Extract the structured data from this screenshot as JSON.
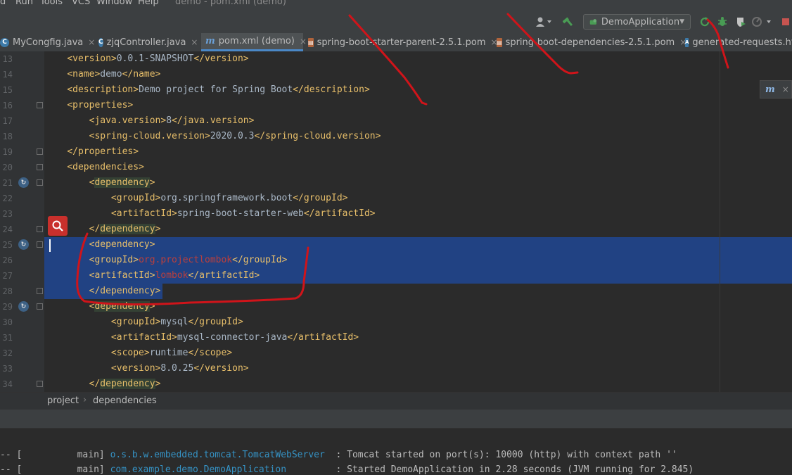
{
  "menubar": {
    "items": [
      {
        "label": "d"
      },
      {
        "label": "Run"
      },
      {
        "label": "Tools"
      },
      {
        "label": "VCS"
      },
      {
        "label": "Window"
      },
      {
        "label": "Help"
      }
    ],
    "window_title": "demo - pom.xml (demo)"
  },
  "toolbar": {
    "run_config": "DemoApplication",
    "icons": [
      "user-icon",
      "hammer-icon",
      "run-config-icon",
      "rerun-icon",
      "debug-icon",
      "coverage-icon",
      "profile-icon",
      "stop-icon"
    ],
    "colors": {
      "run": "#499c54",
      "stop": "#c75450",
      "debug": "#499c54"
    }
  },
  "tabs": [
    {
      "label": "MyCongfig.java",
      "icon": "java-class-icon",
      "active": false
    },
    {
      "label": "zjqController.java",
      "icon": "java-class-icon",
      "active": false
    },
    {
      "label": "pom.xml (demo)",
      "icon": "maven-icon",
      "active": true
    },
    {
      "label": "spring-boot-starter-parent-2.5.1.pom",
      "icon": "pom-file-icon",
      "active": false
    },
    {
      "label": "spring-boot-dependencies-2.5.1.pom",
      "icon": "pom-file-icon",
      "active": false
    },
    {
      "label": "generated-requests.htt",
      "icon": "http-file-icon",
      "active": false
    }
  ],
  "editor": {
    "lines": [
      {
        "num": "13",
        "indent": "    ",
        "parts": [
          [
            "tg",
            "<version>"
          ],
          [
            "tx",
            "0.0.1-SNAPSHOT"
          ],
          [
            "tg",
            "</version>"
          ]
        ]
      },
      {
        "num": "14",
        "indent": "    ",
        "parts": [
          [
            "tg",
            "<name>"
          ],
          [
            "tx",
            "demo"
          ],
          [
            "tg",
            "</name>"
          ]
        ]
      },
      {
        "num": "15",
        "indent": "    ",
        "parts": [
          [
            "tg",
            "<description>"
          ],
          [
            "tx",
            "Demo project for Spring Boot"
          ],
          [
            "tg",
            "</description>"
          ]
        ]
      },
      {
        "num": "16",
        "indent": "    ",
        "parts": [
          [
            "tg",
            "<properties>"
          ]
        ]
      },
      {
        "num": "17",
        "indent": "        ",
        "parts": [
          [
            "tg",
            "<java.version>"
          ],
          [
            "tx",
            "8"
          ],
          [
            "tg",
            "</java.version>"
          ]
        ]
      },
      {
        "num": "18",
        "indent": "        ",
        "parts": [
          [
            "tg",
            "<spring-cloud.version>"
          ],
          [
            "tx",
            "2020.0.3"
          ],
          [
            "tg",
            "</spring-cloud.version>"
          ]
        ]
      },
      {
        "num": "19",
        "indent": "    ",
        "parts": [
          [
            "tg",
            "</properties>"
          ]
        ]
      },
      {
        "num": "20",
        "indent": "    ",
        "parts": [
          [
            "tg",
            "<dependencies>"
          ]
        ]
      },
      {
        "num": "21",
        "indent": "        ",
        "parts": [
          [
            "tg",
            "<"
          ],
          [
            "tgbg",
            "dependency"
          ],
          [
            "tg",
            ">"
          ]
        ]
      },
      {
        "num": "22",
        "indent": "            ",
        "parts": [
          [
            "tg",
            "<groupId>"
          ],
          [
            "tx",
            "org.springframework.boot"
          ],
          [
            "tg",
            "</groupId>"
          ]
        ]
      },
      {
        "num": "23",
        "indent": "            ",
        "parts": [
          [
            "tg",
            "<artifactId>"
          ],
          [
            "tx",
            "spring-boot-starter-web"
          ],
          [
            "tg",
            "</artifactId>"
          ]
        ]
      },
      {
        "num": "24",
        "indent": "        ",
        "parts": [
          [
            "tg",
            "</"
          ],
          [
            "tgbg",
            "dependency"
          ],
          [
            "tg",
            ">"
          ]
        ]
      },
      {
        "num": "25",
        "indent": "        ",
        "parts": [
          [
            "tg",
            "<dependency>"
          ]
        ]
      },
      {
        "num": "26",
        "indent": "        ",
        "parts": [
          [
            "tg",
            "<groupId>"
          ],
          [
            "er",
            "org.projectlombok"
          ],
          [
            "tg",
            "</groupId>"
          ]
        ]
      },
      {
        "num": "27",
        "indent": "        ",
        "parts": [
          [
            "tg",
            "<artifactId>"
          ],
          [
            "er",
            "lombok"
          ],
          [
            "tg",
            "</artifactId>"
          ]
        ]
      },
      {
        "num": "28",
        "indent": "        ",
        "parts": [
          [
            "tg",
            "</dependency>"
          ]
        ]
      },
      {
        "num": "29",
        "indent": "        ",
        "parts": [
          [
            "tg",
            "<"
          ],
          [
            "tgbg",
            "dependency"
          ],
          [
            "tg",
            ">"
          ]
        ]
      },
      {
        "num": "30",
        "indent": "            ",
        "parts": [
          [
            "tg",
            "<groupId>"
          ],
          [
            "tx",
            "mysql"
          ],
          [
            "tg",
            "</groupId>"
          ]
        ]
      },
      {
        "num": "31",
        "indent": "            ",
        "parts": [
          [
            "tg",
            "<artifactId>"
          ],
          [
            "tx",
            "mysql-connector-java"
          ],
          [
            "tg",
            "</artifactId>"
          ]
        ]
      },
      {
        "num": "32",
        "indent": "            ",
        "parts": [
          [
            "tg",
            "<scope>"
          ],
          [
            "tx",
            "runtime"
          ],
          [
            "tg",
            "</scope>"
          ]
        ]
      },
      {
        "num": "33",
        "indent": "            ",
        "parts": [
          [
            "tg",
            "<version>"
          ],
          [
            "tx",
            "8.0.25"
          ],
          [
            "tg",
            "</version>"
          ]
        ]
      },
      {
        "num": "34",
        "indent": "        ",
        "parts": [
          [
            "tg",
            "</"
          ],
          [
            "tgbg",
            "dependency"
          ],
          [
            "tg",
            ">"
          ]
        ]
      }
    ],
    "selected_lines": [
      "25",
      "26",
      "27",
      "28"
    ]
  },
  "breadcrumb": {
    "items": [
      "project",
      "dependencies"
    ],
    "separator": "›"
  },
  "console": {
    "lines": [
      {
        "prefix": "-- [",
        "thread": "main]",
        "cls": "o.s.b.w.embedded.tomcat.TomcatWebServer",
        "msg": ": Tomcat started on port(s): 10000 (http) with context path ''"
      },
      {
        "prefix": "-- [",
        "thread": "main]",
        "cls": "com.example.demo.DemoApplication",
        "msg": ": Started DemoApplication in 2.28 seconds (JVM running for 2.845)"
      }
    ]
  }
}
